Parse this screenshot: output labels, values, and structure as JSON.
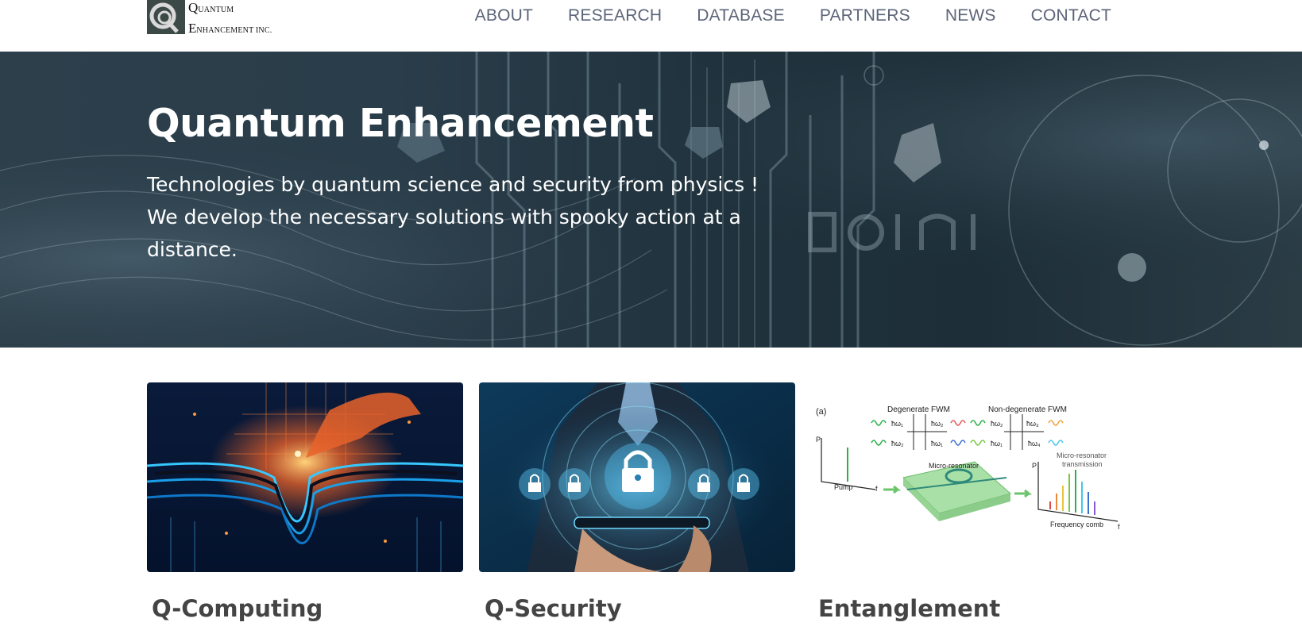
{
  "header": {
    "logo": {
      "line1_initial": "Q",
      "line1_rest": "UANTUM",
      "line2_initial": "E",
      "line2_rest": "NHANCEMENT INC."
    },
    "nav": [
      "ABOUT",
      "RESEARCH",
      "DATABASE",
      "PARTNERS",
      "NEWS",
      "CONTACT"
    ]
  },
  "hero": {
    "title": "Quantum Enhancement",
    "subtitle_lines": [
      "Technologies by quantum science and security from physics !",
      "We develop the necessary solutions with spooky action at a",
      "distance."
    ]
  },
  "cards": [
    {
      "title": "Q-Computing"
    },
    {
      "title": "Q-Security"
    },
    {
      "title": "Entanglement",
      "figure": {
        "panel": "(a)",
        "label_degenerate": "Degenerate FWM",
        "label_nondegenerate": "Non-degenerate FWM",
        "label_pump": "Pump",
        "label_microresonator": "Micro-resonator",
        "label_transmission_1": "Micro-resonator",
        "label_transmission_2": "transmission",
        "label_comb": "Frequency comb",
        "axis_p": "P",
        "axis_f": "f",
        "omega_labels": [
          "ħω₂",
          "ħω₁",
          "ħω₁",
          "ħω₂",
          "ħω₃",
          "ħω₂",
          "ħω₁",
          "ħω₄"
        ]
      }
    }
  ],
  "colors": {
    "nav": "#5b6478",
    "card_title": "#444444",
    "hero_text": "#ffffff"
  }
}
